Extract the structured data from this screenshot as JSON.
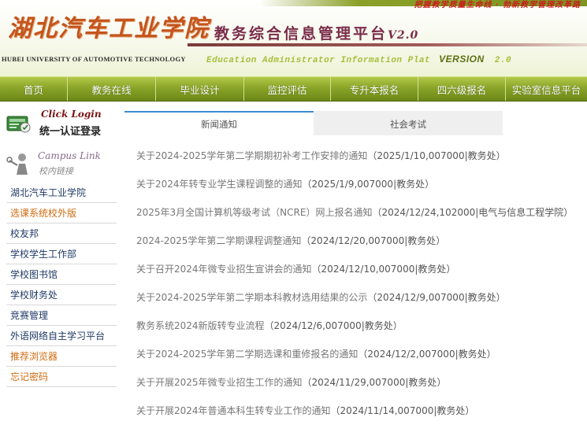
{
  "header": {
    "slogan": "把握教学质量生命线 · 勃新教学管理改革路",
    "school_cn": "湖北汽车工业学院",
    "school_en": "HUBEI UNIVERSITY OF AUTOMOTIVE TECHNOLOGY",
    "system_title": "教务综合信息管理平台",
    "system_version": "V2.0",
    "system_en": "Education Administrator Information Plat",
    "system_en_version_word": "VERSION",
    "system_en_version_num": "2.0"
  },
  "nav": [
    "首页",
    "教务在线",
    "毕业设计",
    "监控评估",
    "专升本报名",
    "四六级报名",
    "实验室信息平台"
  ],
  "login": {
    "en": "Click  Login",
    "cn": "统一认证登录",
    "icon": "login-card-icon"
  },
  "campus_link": {
    "en": "Campus Link",
    "cn": "校内链接",
    "icon": "campus-person-icon"
  },
  "links": [
    {
      "label": "湖北汽车工业学院",
      "highlight": false
    },
    {
      "label": "选课系统校外版",
      "highlight": true
    },
    {
      "label": "校友邦",
      "highlight": false
    },
    {
      "label": "学校学生工作部",
      "highlight": false
    },
    {
      "label": "学校图书馆",
      "highlight": false
    },
    {
      "label": "学校财务处",
      "highlight": false
    },
    {
      "label": "竞赛管理",
      "highlight": false
    },
    {
      "label": "外语网络自主学习平台",
      "highlight": false
    },
    {
      "label": "推荐浏览器",
      "highlight": true
    },
    {
      "label": "忘记密码",
      "highlight": true
    }
  ],
  "tabs": {
    "news": "新闻通知",
    "exam": "社会考试"
  },
  "news": [
    {
      "title": "关于2024-2025学年第二学期期初补考工作安排的通知",
      "meta": "（2025/1/10,007000|教务处）"
    },
    {
      "title": "关于2024年转专业学生课程调整的通知",
      "meta": "（2025/1/9,007000|教务处）"
    },
    {
      "title": "2025年3月全国计算机等级考试（NCRE）网上报名通知",
      "meta": "（2024/12/24,102000|电气与信息工程学院）"
    },
    {
      "title": "2024-2025学年第二学期课程调整通知",
      "meta": "（2024/12/20,007000|教务处）"
    },
    {
      "title": "关于召开2024年微专业招生宣讲会的通知",
      "meta": "（2024/12/10,007000|教务处）"
    },
    {
      "title": "关于2024-2025学年第二学期本科教材选用结果的公示",
      "meta": "（2024/12/9,007000|教务处）"
    },
    {
      "title": "教务系统2024新版转专业流程",
      "meta": "（2024/12/6,007000|教务处）"
    },
    {
      "title": "关于2024-2025学年第二学期选课和重修报名的通知",
      "meta": "（2024/12/2,007000|教务处）"
    },
    {
      "title": "关于开展2025年微专业招生工作的通知",
      "meta": "（2024/11/29,007000|教务处）"
    },
    {
      "title": "关于开展2024年普通本科生转专业工作的通知",
      "meta": "（2024/11/14,007000|教务处）"
    }
  ]
}
